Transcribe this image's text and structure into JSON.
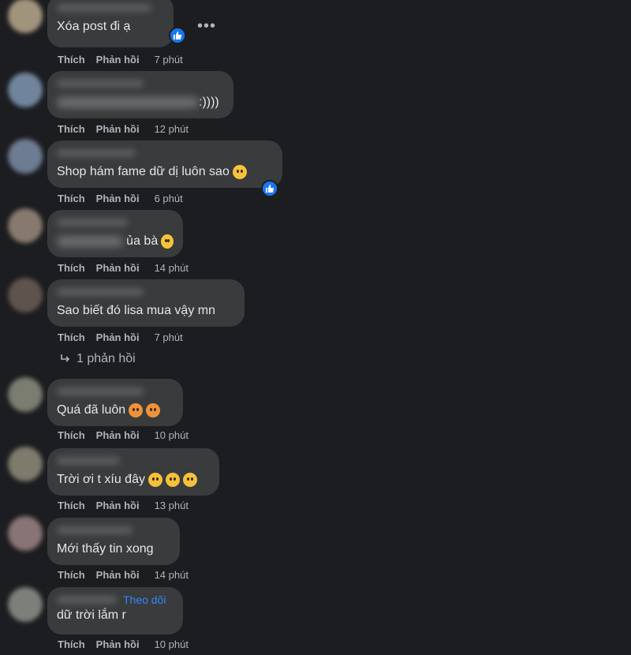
{
  "actions": {
    "like": "Thích",
    "reply": "Phản hồi"
  },
  "comments": [
    {
      "text": "Xóa post đi ạ",
      "time": "7 phút",
      "reacted": true
    },
    {
      "text": ":))))",
      "time": "12 phút"
    },
    {
      "text": "Shop hám fame dữ dị luôn sao",
      "time": "6 phút",
      "reacted": true
    },
    {
      "text": "ủa bà",
      "time": "14 phút"
    },
    {
      "text": "Sao biết đó lisa mua vậy mn",
      "time": "7 phút"
    },
    {
      "text": "Quá đã luôn",
      "time": "10 phút"
    },
    {
      "text": "Trời ơi t xíu đây",
      "time": "13 phút"
    },
    {
      "text": "Mới thấy tin xong",
      "time": "14 phút"
    },
    {
      "text": "dữ trời lắm r",
      "time": "10 phút",
      "follow": "Theo dõi"
    }
  ],
  "replies_link": "1 phản hồi",
  "more_icon": "more-options-icon",
  "colors": {
    "background": "#1c1d20",
    "bubble": "#3a3b3c",
    "link": "#2d88ff",
    "like": "#1877f2"
  }
}
